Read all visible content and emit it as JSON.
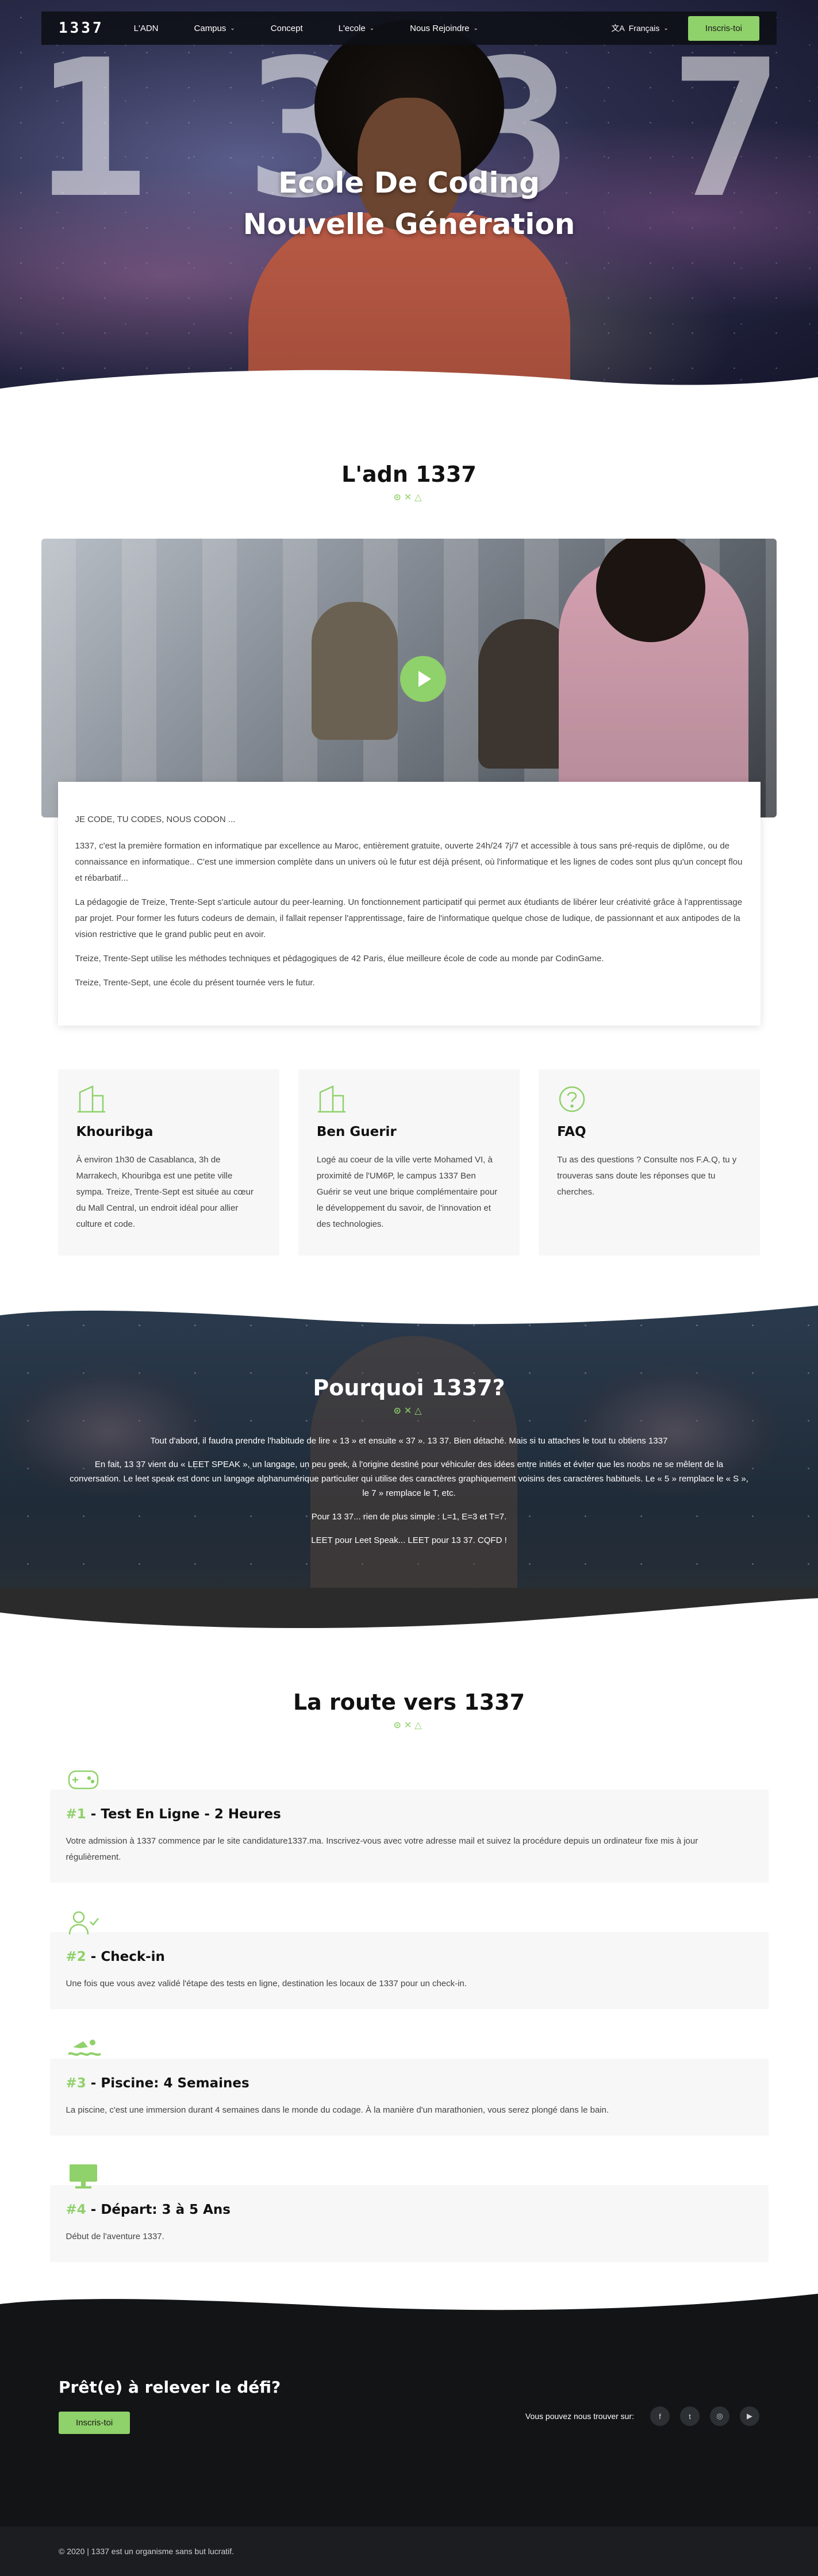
{
  "nav": {
    "logo": "1337",
    "items": [
      {
        "label": "L'ADN",
        "dropdown": false
      },
      {
        "label": "Campus",
        "dropdown": true
      },
      {
        "label": "Concept",
        "dropdown": false
      },
      {
        "label": "L'ecole",
        "dropdown": true
      },
      {
        "label": "Nous Rejoindre",
        "dropdown": true
      }
    ],
    "language": "Français",
    "cta": "Inscris-toi"
  },
  "hero": {
    "title_line1": "Ecole De Coding",
    "title_line2": "Nouvelle Génération",
    "bg_digits": "1337"
  },
  "section_icons": "⊙✕△",
  "adn": {
    "title": "L'adn 1337",
    "paragraphs": [
      "JE CODE, TU CODES, NOUS CODON ...",
      "1337, c'est la première formation en informatique par excellence au Maroc, entièrement gratuite, ouverte 24h/24 7j/7 et accessible à tous sans pré-requis de diplôme, ou de connaissance en informatique.. C'est une immersion complète dans un univers où le futur est déjà présent, où l'informatique et les lignes de codes sont plus qu'un concept flou et rébarbatif...",
      "La pédagogie de Treize, Trente-Sept s'articule autour du peer-learning. Un fonctionnement participatif qui permet aux étudiants de libérer leur créativité grâce à l'apprentissage par projet. Pour former les futurs codeurs de demain, il fallait repenser l'apprentissage, faire de l'informatique quelque chose de ludique, de passionnant et aux antipodes de la vision restrictive que le grand public peut en avoir.",
      "Treize, Trente-Sept utilise les méthodes techniques et pédagogiques de 42 Paris, élue meilleure école de code au monde par CodinGame.",
      "Treize, Trente-Sept, une école du présent tournée vers le futur."
    ]
  },
  "cards": [
    {
      "icon": "building-icon",
      "title": "Khouribga",
      "text": "À environ 1h30 de Casablanca, 3h de Marrakech, Khouribga est une petite ville sympa. Treize, Trente-Sept est située au cœur du Mall Central, un endroit idéal pour allier culture et code."
    },
    {
      "icon": "building-icon",
      "title": "Ben Guerir",
      "text": "Logé au coeur de la ville verte Mohamed VI, à proximité de l'UM6P, le campus 1337 Ben Guérir se veut une brique complémentaire pour le développement du savoir, de l'innovation et des technologies."
    },
    {
      "icon": "question-circle-icon",
      "title": "FAQ",
      "text": "Tu as des questions ? Consulte nos F.A.Q, tu y trouveras sans doute les réponses que tu cherches."
    }
  ],
  "pourquoi": {
    "title": "Pourquoi 1337?",
    "paragraphs": [
      "Tout d'abord, il faudra prendre l'habitude de lire « 13 » et ensuite « 37 ». 13 37. Bien détaché. Mais si tu attaches le tout tu obtiens 1337",
      "En fait, 13 37 vient du « LEET SPEAK », un langage, un peu geek, à l'origine destiné pour véhiculer des idées entre initiés et éviter que les noobs ne se mêlent de la conversation. Le leet speak est donc un langage alphanumérique particulier qui utilise des caractères graphiquement voisins des caractères habituels. Le « 5 » remplace le « S », le 7 » remplace le T, etc.",
      "Pour 13 37... rien de plus simple : L=1, E=3 et T=7.",
      "LEET pour Leet Speak... LEET pour 13 37. CQFD !"
    ]
  },
  "route": {
    "title": "La route vers 1337",
    "steps": [
      {
        "icon": "gamepad-icon",
        "glyph": "🎮",
        "num": "#1",
        "title": " - Test En Ligne - 2 Heures",
        "text": "Votre admission à 1337 commence par le site candidature1337.ma. Inscrivez-vous avec votre adresse mail et suivez la procédure depuis un ordinateur fixe mis à jour régulièrement."
      },
      {
        "icon": "user-check-icon",
        "glyph": "👤✓",
        "num": "#2",
        "title": " - Check-in",
        "text": "Une fois que vous avez validé l'étape des tests en ligne, destination les locaux de 1337 pour un check-in."
      },
      {
        "icon": "swimmer-icon",
        "glyph": "🏊",
        "num": "#3",
        "title": " - Piscine: 4 Semaines",
        "text": "La piscine, c'est une immersion durant 4 semaines dans le monde du codage. À la manière d'un marathonien, vous serez plongé dans le bain."
      },
      {
        "icon": "monitor-icon",
        "glyph": "🖥",
        "num": "#4",
        "title": " - Départ: 3 à 5 Ans",
        "text": "Début de l'aventure 1337."
      }
    ]
  },
  "footer": {
    "cta_title": "Prêt(e) à relever le défi?",
    "cta_button": "Inscris-toi",
    "social_label": "Vous pouvez nous trouver sur:",
    "social": [
      {
        "icon": "facebook-icon",
        "glyph": "f"
      },
      {
        "icon": "twitter-icon",
        "glyph": "t"
      },
      {
        "icon": "instagram-icon",
        "glyph": "◎"
      },
      {
        "icon": "youtube-icon",
        "glyph": "▶"
      }
    ],
    "copyright": "© 2020 | 1337 est un organisme sans but lucratif."
  },
  "colors": {
    "accent": "#8fd16a",
    "dark": "#121416"
  }
}
